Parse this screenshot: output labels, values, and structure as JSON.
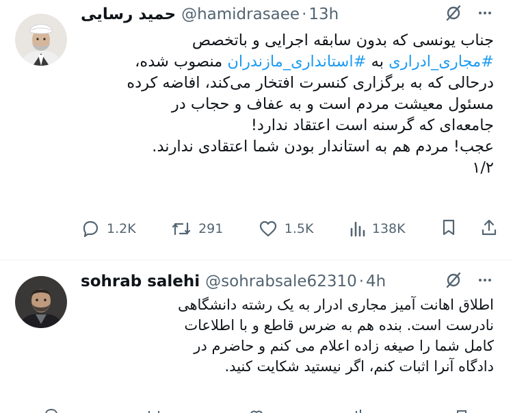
{
  "tweets": [
    {
      "author_name": "حمید رسایی",
      "handle": "@hamidrasaee",
      "time": "13h",
      "body_lines": [
        "جناب یونسی که بدون سابقه اجرایی و باتخصص",
        [
          "#مجاری_ادراری",
          " به ",
          "#استانداری_مازندران",
          " منصوب شده،"
        ],
        "درحالی که به برگزاری کنسرت افتخار می‌کند، افاضه کرده",
        "مسئول معیشت مردم است و به عفاف و حجاب در",
        "جامعه‌ای که گرسنه است اعتقاد ندارد!",
        "عجب! مردم هم به استاندار بودن شما اعتقادی ندارند.",
        "۱/۲"
      ],
      "hashtag1": "#مجاری_ادراری",
      "connector": " به ",
      "hashtag2": "#استانداری_مازندران",
      "hashtag_tail": " منصوب شده،",
      "line1": "جناب یونسی که بدون سابقه اجرایی و باتخصص",
      "line3": "درحالی که به برگزاری کنسرت افتخار می‌کند، افاضه کرده",
      "line4": "مسئول معیشت مردم است و به عفاف و حجاب در",
      "line5": "جامعه‌ای که گرسنه است اعتقاد ندارد!",
      "line6": "عجب! مردم هم به استاندار بودن شما اعتقادی ندارند.",
      "line7": "۱/۲",
      "replies": "1.2K",
      "retweets": "291",
      "likes": "1.5K",
      "views": "138K"
    },
    {
      "author_name": "sohrab salehi",
      "handle": "@sohrabsale62310",
      "time": "4h",
      "line1": "اطلاق اهانت آمیز مجاری ادرار به یک رشته دانشگاهی",
      "line2": "نادرست است. بنده هم به ضرس قاطع و با اطلاعات",
      "line3": "کامل شما را صیغه زاده اعلام می کنم و حاضرم در",
      "line4": "دادگاه آنرا اثبات کنم، اگر نیستید شکایت کنید."
    }
  ],
  "separator": "·",
  "icons": [
    "grok-icon",
    "more-icon",
    "reply-icon",
    "retweet-icon",
    "like-icon",
    "views-icon",
    "bookmark-icon",
    "share-icon"
  ],
  "colors": {
    "text": "#0f1419",
    "muted": "#536471",
    "link": "#1d9bf0",
    "divider": "#eff3f4"
  }
}
